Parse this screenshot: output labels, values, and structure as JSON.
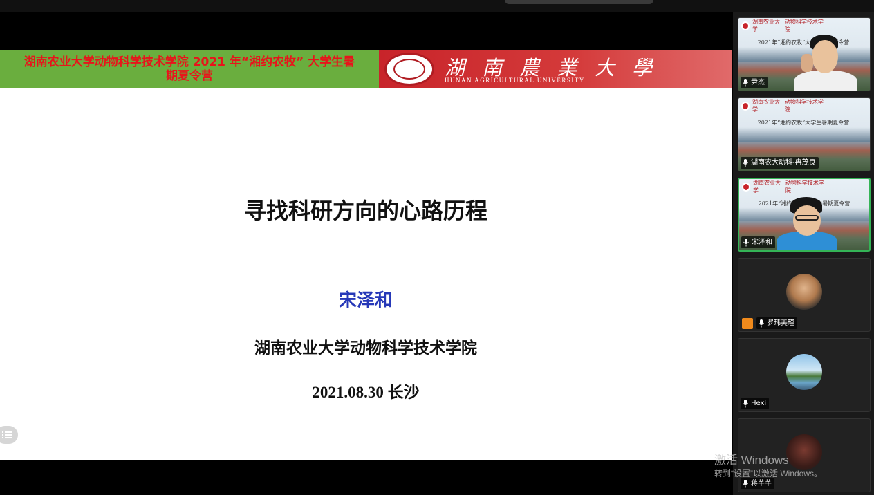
{
  "slide": {
    "banner_text_line1": "湖南农业大学动物科学技术学院 2021 年“湘约农牧” 大学生暑",
    "banner_text_line2": "期夏令营",
    "university_name_cn": "湖 南 農 業 大 學",
    "university_name_en": "HUNAN AGRICULTURAL UNIVERSITY",
    "title": "寻找科研方向的心路历程",
    "author": "宋泽和",
    "institution": "湖南农业大学动物科学技术学院",
    "date_place": "2021.08.30 长沙",
    "colors": {
      "banner_green": "#6aae3e",
      "banner_red": "#c8242a",
      "banner_text": "#e8141b",
      "author": "#2638b8"
    }
  },
  "thumbnail_slide": {
    "university_name_cn": "湖南农业大学",
    "college_name_cn": "动物科学技术学院",
    "camp_title": "2021年“湘约农牧”大学生暑期夏令营"
  },
  "participants": [
    {
      "name": "尹杰",
      "mode": "video",
      "active": false,
      "icon": "mic-icon"
    },
    {
      "name": "湖南农大动科-冉茂良",
      "mode": "screen",
      "active": false,
      "icon": "mic-icon"
    },
    {
      "name": "宋泽和",
      "mode": "video",
      "active": true,
      "icon": "mic-icon"
    },
    {
      "name": "罗玮美瑾",
      "mode": "avatar",
      "active": false,
      "icon": "mic-icon",
      "host_badge": true
    },
    {
      "name": "Hexi",
      "mode": "avatar",
      "active": false,
      "icon": "mic-icon"
    },
    {
      "name": "蒋芊芊",
      "mode": "avatar",
      "active": false,
      "icon": "mic-icon"
    }
  ],
  "watermark": {
    "line1": "激活 Windows",
    "line2": "转到“设置”以激活 Windows。"
  },
  "controls": {
    "slide_list_icon": "list-icon"
  }
}
